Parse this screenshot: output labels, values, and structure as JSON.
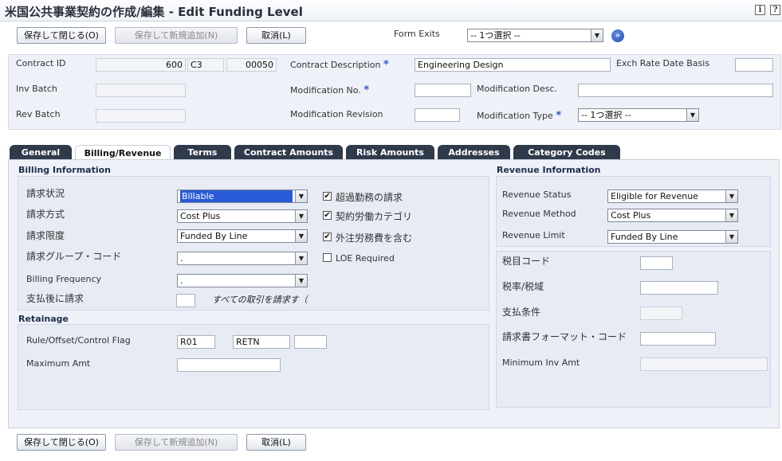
{
  "window": {
    "title": "米国公共事業契約の作成/編集 - Edit Funding Level",
    "info_icon": "i",
    "help_icon": "?"
  },
  "toolbar": {
    "save_close": "保存して閉じる(O)",
    "save_add": "保存して新規追加(N)",
    "cancel": "取消(L)",
    "form_exits_label": "Form Exits",
    "form_exits_value": "-- 1つ選択 --",
    "go_label": "»"
  },
  "header": {
    "contract_id_label": "Contract ID",
    "contract_id_num": "600",
    "contract_id_type": "C3",
    "contract_id_co": "00050",
    "inv_batch_label": "Inv Batch",
    "rev_batch_label": "Rev Batch",
    "contract_desc_label": "Contract Description",
    "contract_desc_value": "Engineering Design",
    "exch_rate_label": "Exch Rate Date Basis",
    "mod_no_label": "Modification No.",
    "mod_desc_label": "Modification Desc.",
    "mod_rev_label": "Modification Revision",
    "mod_type_label": "Modification Type",
    "mod_type_value": "-- 1つ選択 --",
    "required_mark": "*"
  },
  "tabs": [
    {
      "label": "General"
    },
    {
      "label": "Billing/Revenue"
    },
    {
      "label": "Terms"
    },
    {
      "label": "Contract Amounts"
    },
    {
      "label": "Risk Amounts"
    },
    {
      "label": "Addresses"
    },
    {
      "label": "Category Codes"
    }
  ],
  "billing": {
    "title": "Billing Information",
    "status_label": "請求状況",
    "status_value": "Billable",
    "method_label": "請求方式",
    "method_value": "Cost Plus",
    "limit_label": "請求限度",
    "limit_value": "Funded By Line",
    "group_code_label": "請求グループ・コード",
    "group_code_value": ".",
    "frequency_label": "Billing Frequency",
    "frequency_value": ".",
    "after_pay_label": "支払後に請求",
    "after_pay_note": "すべての取引を請求す（",
    "overtime_label": "超過勤務の請求",
    "overtime_checked": "✔",
    "contract_labor_label": "契約労働カテゴリ",
    "contract_labor_checked": "✔",
    "outsourced_label": "外注労務費を含む",
    "outsourced_checked": "✔",
    "loe_label": "LOE Required",
    "loe_checked": ""
  },
  "retainage": {
    "title": "Retainage",
    "rule_label": "Rule/Offset/Control Flag",
    "rule_value": "R01",
    "offset_value": "RETN",
    "flag_value": "",
    "max_amt_label": "Maximum Amt"
  },
  "revenue": {
    "title": "Revenue Information",
    "status_label": "Revenue Status",
    "status_value": "Eligible for Revenue",
    "method_label": "Revenue Method",
    "method_value": "Cost Plus",
    "limit_label": "Revenue Limit",
    "limit_value": "Funded By Line"
  },
  "tax": {
    "tax_code_label": "税目コード",
    "tax_rate_label": "税率/税域",
    "pay_terms_label": "支払条件",
    "invoice_format_label": "請求書フォーマット・コード",
    "min_inv_label": "Minimum Inv Amt"
  },
  "footer": {
    "save_close": "保存して閉じる(O)",
    "save_add": "保存して新規追加(N)",
    "cancel": "取消(L)"
  }
}
